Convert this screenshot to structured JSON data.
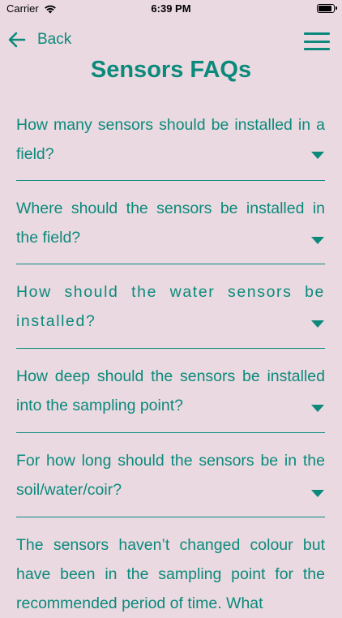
{
  "status_bar": {
    "carrier": "Carrier",
    "time": "6:39 PM"
  },
  "nav": {
    "back_label": "Back"
  },
  "page": {
    "title": "Sensors FAQs"
  },
  "faqs": [
    {
      "question": "How many sensors should be installed in a field?"
    },
    {
      "question": "Where should the sensors be installed in the field?"
    },
    {
      "question": "How should the water sensors be installed?"
    },
    {
      "question": "How deep should the sensors be installed into the sampling point?"
    },
    {
      "question": "For how long should the sensors be in the soil/water/coir?"
    },
    {
      "question": "The sensors haven’t changed colour but have been in the sampling point for the recommended period of time. What"
    }
  ],
  "colors": {
    "background": "#ead9e0",
    "accent": "#0b8a7c"
  }
}
